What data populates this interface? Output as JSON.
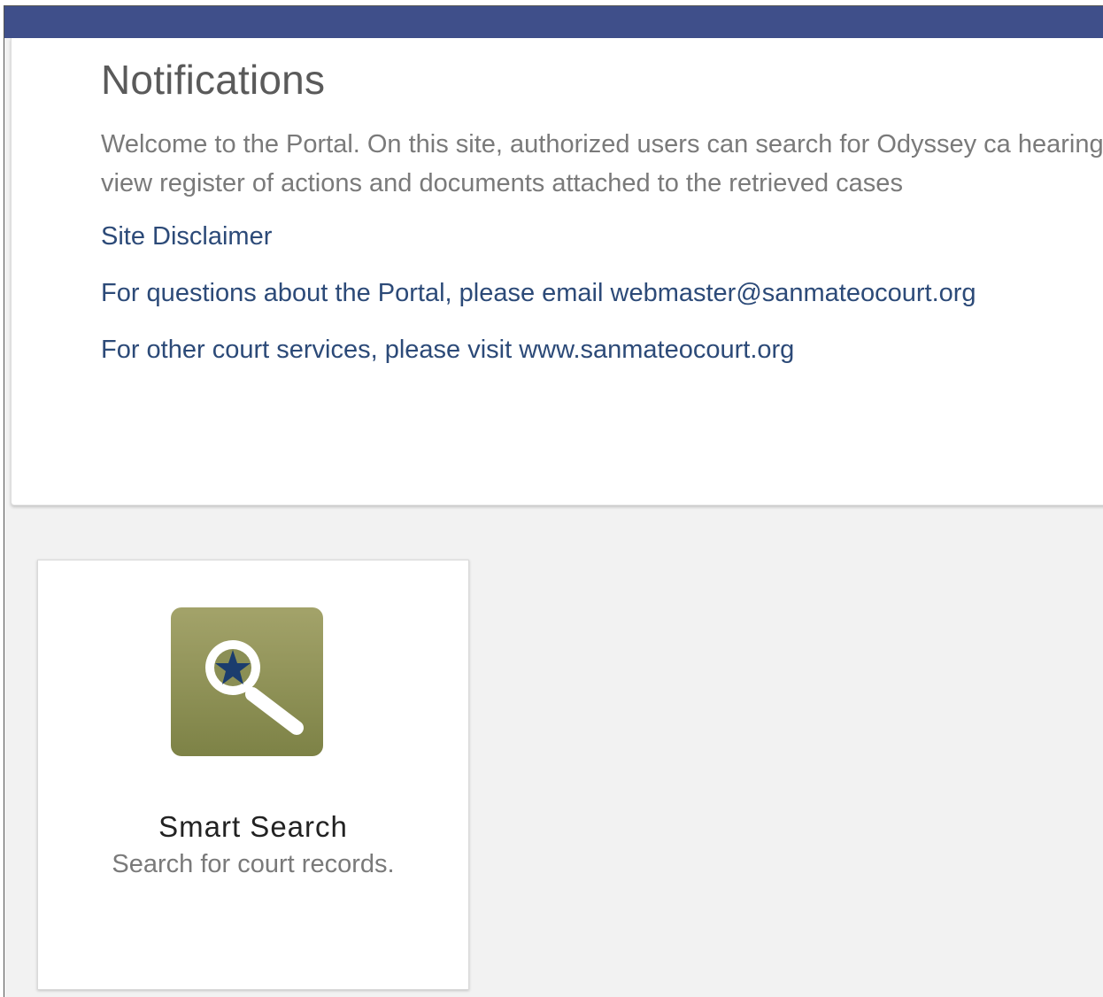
{
  "header": {
    "bar_color": "#3f4f8a"
  },
  "notifications": {
    "title": "Notifications",
    "welcome_text": "Welcome to the Portal. On this site, authorized users can search for Odyssey ca hearings, view register of actions and documents attached to the retrieved cases",
    "disclaimer_link": "Site Disclaimer",
    "email_line": "For questions about the Portal, please email webmaster@sanmateocourt.org",
    "visit_line": "For other court services, please visit www.sanmateocourt.org"
  },
  "tiles": [
    {
      "title": "Smart Search",
      "subtitle": "Search for court records.",
      "icon": "magnifier-star-icon",
      "icon_color": "#8b8f55"
    }
  ]
}
